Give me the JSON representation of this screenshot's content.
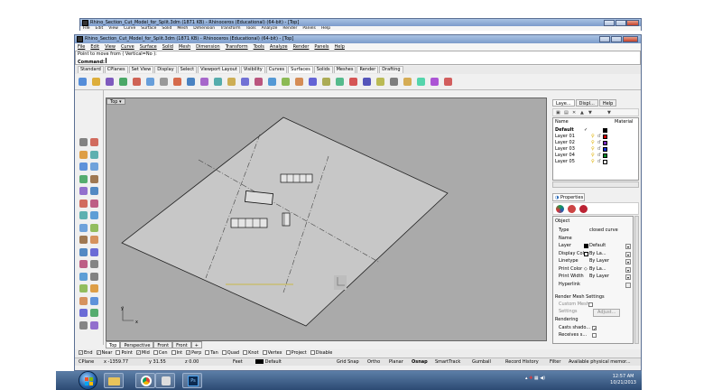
{
  "back_window": {
    "title": "Rhino_Section_Cut_Model_for_Split.3dm (1871 KB) - Rhinoceros (Educational) (64-bit) - [Top]"
  },
  "back_menu": [
    "File",
    "Edit",
    "View",
    "Curve",
    "Surface",
    "Solid",
    "Mesh",
    "Dimension",
    "Transform",
    "Tools",
    "Analyze",
    "Render",
    "Panels",
    "Help"
  ],
  "window": {
    "title": "Rhino_Section_Cut_Model_for_Split.3dm (1871 KB) - Rhinoceros (Educational) (64-bit) - [Top]"
  },
  "menu": [
    "File",
    "Edit",
    "View",
    "Curve",
    "Surface",
    "Solid",
    "Mesh",
    "Dimension",
    "Transform",
    "Tools",
    "Analyze",
    "Render",
    "Panels",
    "Help"
  ],
  "command": {
    "history": "Point to move from ( Vertical=No ):",
    "prompt": "Command:"
  },
  "toolbar_tabs": [
    "Standard",
    "CPlanes",
    "Set View",
    "Display",
    "Select",
    "Viewport Layout",
    "Visibility",
    "Curves",
    "Surfaces",
    "Solids",
    "Meshes",
    "Render",
    "Drafting"
  ],
  "active_toolbar_tab": "Surfaces",
  "viewport": {
    "title": "Top",
    "axis_y": "y",
    "axis_x": "x"
  },
  "viewport_tabs": [
    "Top",
    "Perspective",
    "Front",
    "Front"
  ],
  "layers_panel": {
    "tabs": [
      "Laye...",
      "Displ...",
      "Help"
    ],
    "headers": [
      "Name",
      "Material"
    ],
    "layers": [
      {
        "name": "Default",
        "current": "✓",
        "color": "#000000"
      },
      {
        "name": "Layer 01",
        "current": "",
        "color": "#cc0000"
      },
      {
        "name": "Layer 02",
        "current": "",
        "color": "#7a2fbf"
      },
      {
        "name": "Layer 03",
        "current": "",
        "color": "#1030d0"
      },
      {
        "name": "Layer 04",
        "current": "",
        "color": "#0a8a2a"
      },
      {
        "name": "Layer 05",
        "current": "",
        "color": "#ffffff"
      }
    ]
  },
  "properties_panel": {
    "tab": "Properties",
    "section": "Object",
    "rows": [
      {
        "label": "Type",
        "value": "closed curve"
      },
      {
        "label": "Name",
        "value": ""
      },
      {
        "label": "Layer",
        "value": "Default"
      },
      {
        "label": "Display Color",
        "value": "By La..."
      },
      {
        "label": "Linetype",
        "value": "By Layer"
      },
      {
        "label": "Print Color",
        "value": "By La..."
      },
      {
        "label": "Print Width",
        "value": "By Layer"
      },
      {
        "label": "Hyperlink",
        "value": ""
      }
    ],
    "render_mesh": "Render Mesh Settings",
    "custom_mesh": "Custom Mesh",
    "settings": "Settings",
    "adjust": "Adjust...",
    "rendering": "Rendering",
    "casts_shadows": "Casts shado...",
    "receives": "Receives s..."
  },
  "osnaps": [
    {
      "label": "End",
      "on": true
    },
    {
      "label": "Near",
      "on": true
    },
    {
      "label": "Point",
      "on": false
    },
    {
      "label": "Mid",
      "on": true
    },
    {
      "label": "Cen",
      "on": false
    },
    {
      "label": "Int",
      "on": false
    },
    {
      "label": "Perp",
      "on": true
    },
    {
      "label": "Tan",
      "on": false
    },
    {
      "label": "Quad",
      "on": false
    },
    {
      "label": "Knot",
      "on": false
    },
    {
      "label": "Vertex",
      "on": false
    },
    {
      "label": "Project",
      "on": false
    },
    {
      "label": "Disable",
      "on": false
    }
  ],
  "status": {
    "cplane": "CPlane",
    "x": "x -1359.77",
    "y": "y 31.55",
    "z": "z 0.00",
    "units": "Feet",
    "layer": "Default",
    "grid_snap": "Grid Snap",
    "ortho": "Ortho",
    "planar": "Planar",
    "osnap": "Osnap",
    "smarttrack": "SmartTrack",
    "gumball": "Gumball",
    "record_history": "Record History",
    "filter": "Filter",
    "memory": "Available physical memor..."
  },
  "taskbar": {
    "time": "12:57 AM",
    "date": "10/21/2013"
  }
}
